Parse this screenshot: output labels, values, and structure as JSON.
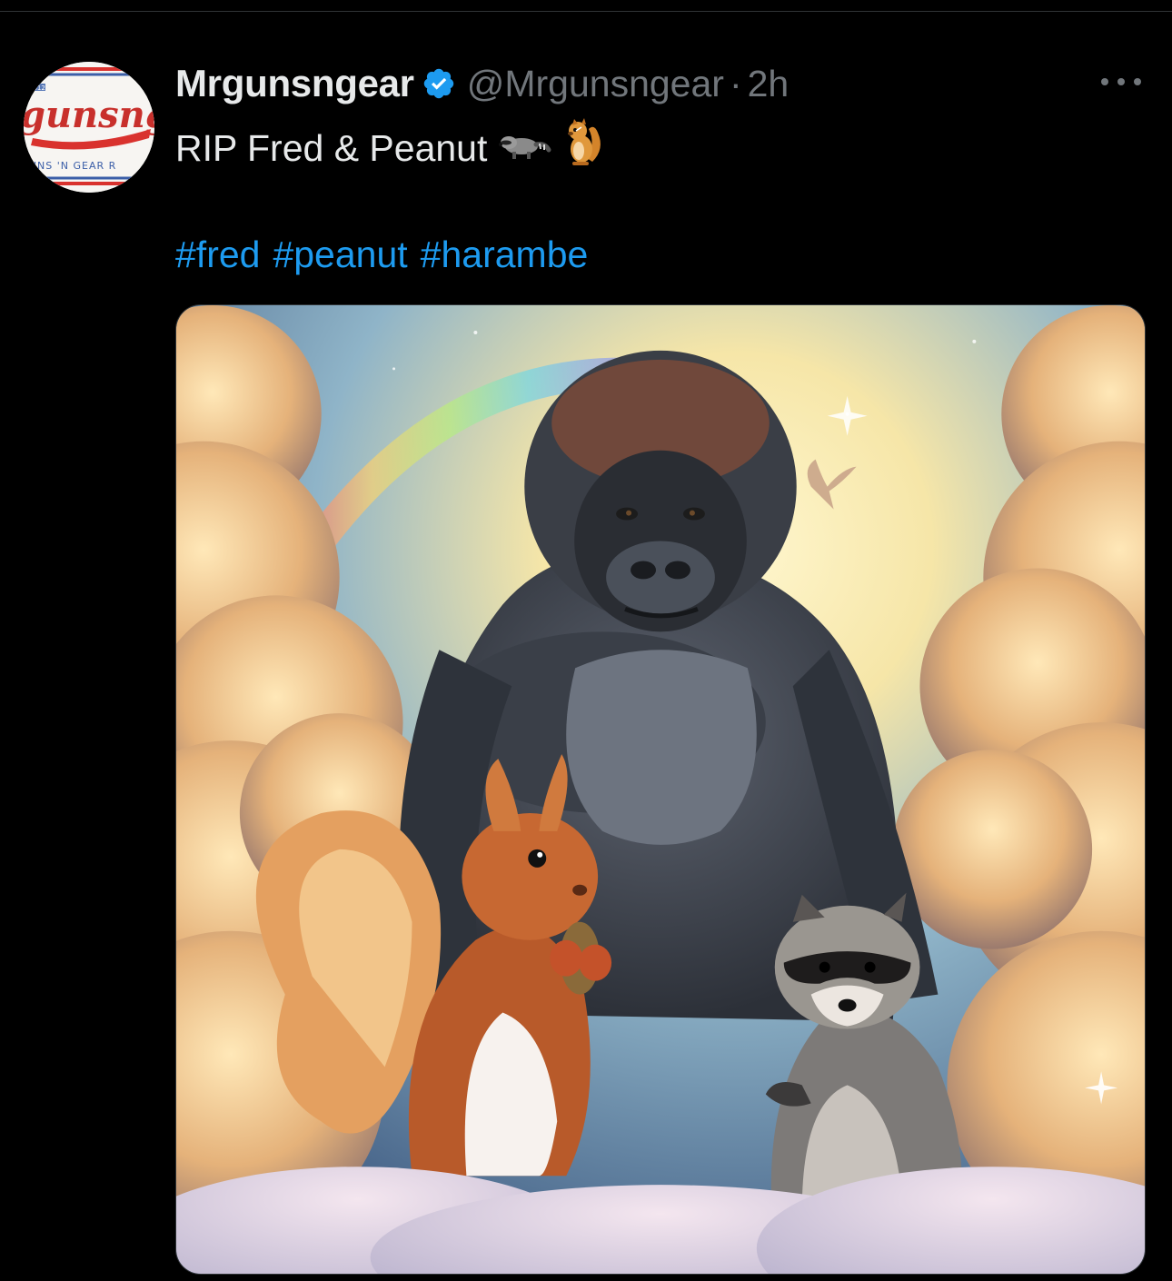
{
  "tweet": {
    "author": {
      "display_name": "Mrgunsngear",
      "handle": "@Mrgunsngear",
      "verified": true,
      "avatar_icon": "mrgunsngear-logo-avatar",
      "avatar_logo_text": "gunsng",
      "avatar_tagline_text": "UNS 'N GEAR R",
      "avatar_est_text": "2012"
    },
    "separator": "·",
    "time": "2h",
    "text": "RIP Fred & Peanut",
    "emojis": [
      "raccoon-emoji-icon",
      "chipmunk-emoji-icon"
    ],
    "hashtags": [
      "#fred",
      "#peanut",
      "#harambe"
    ],
    "media": {
      "type": "image",
      "description_icon": "gorilla-squirrel-raccoon-heaven-illustration"
    }
  },
  "colors": {
    "background": "#000000",
    "text_primary": "#e7e9ea",
    "text_secondary": "#71767b",
    "link": "#1d9bf0",
    "verified": "#1d9bf0"
  }
}
